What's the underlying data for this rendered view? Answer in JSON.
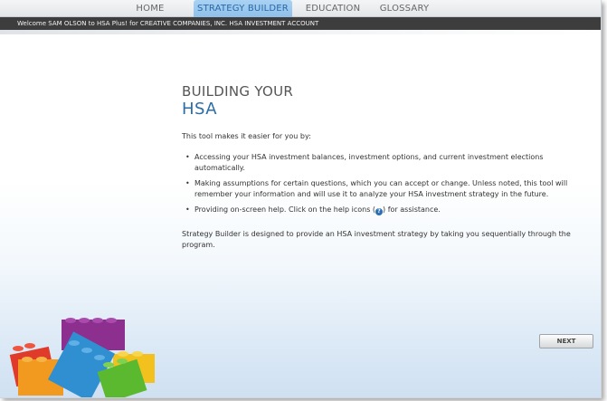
{
  "nav": {
    "tabs": [
      {
        "label": "HOME"
      },
      {
        "label": "STRATEGY BUILDER"
      },
      {
        "label": "EDUCATION"
      },
      {
        "label": "GLOSSARY"
      }
    ],
    "active_tab": "STRATEGY BUILDER"
  },
  "welcome_bar": {
    "text": "Welcome SAM OLSON to HSA Plus! for CREATIVE COMPANIES, INC. HSA INVESTMENT ACCOUNT"
  },
  "main": {
    "heading_line1": "BUILDING YOUR",
    "heading_line2": "HSA",
    "intro": "This tool makes it easier for you by:",
    "bullets": [
      {
        "text": "Accessing your HSA investment balances, investment options, and current investment elections automatically."
      },
      {
        "text": "Making assumptions for certain questions, which you can accept or change. Unless noted, this tool will remember your information and will use it to analyze your HSA investment strategy in the future."
      },
      {
        "text_before": "Providing on-screen help. Click on the help icons (",
        "help_icon_glyph": "?",
        "text_after": ") for assistance."
      }
    ],
    "closing": "Strategy Builder is designed to provide an HSA investment strategy by taking you sequentially through the program."
  },
  "actions": {
    "next_label": "NEXT"
  },
  "colors": {
    "accent_blue": "#2b6da6",
    "active_tab_bg": "#9ccaef",
    "welcome_bar_bg": "#3d3d3d"
  },
  "icons": {
    "decoration": "building-blocks-image",
    "help": "help-icon"
  }
}
